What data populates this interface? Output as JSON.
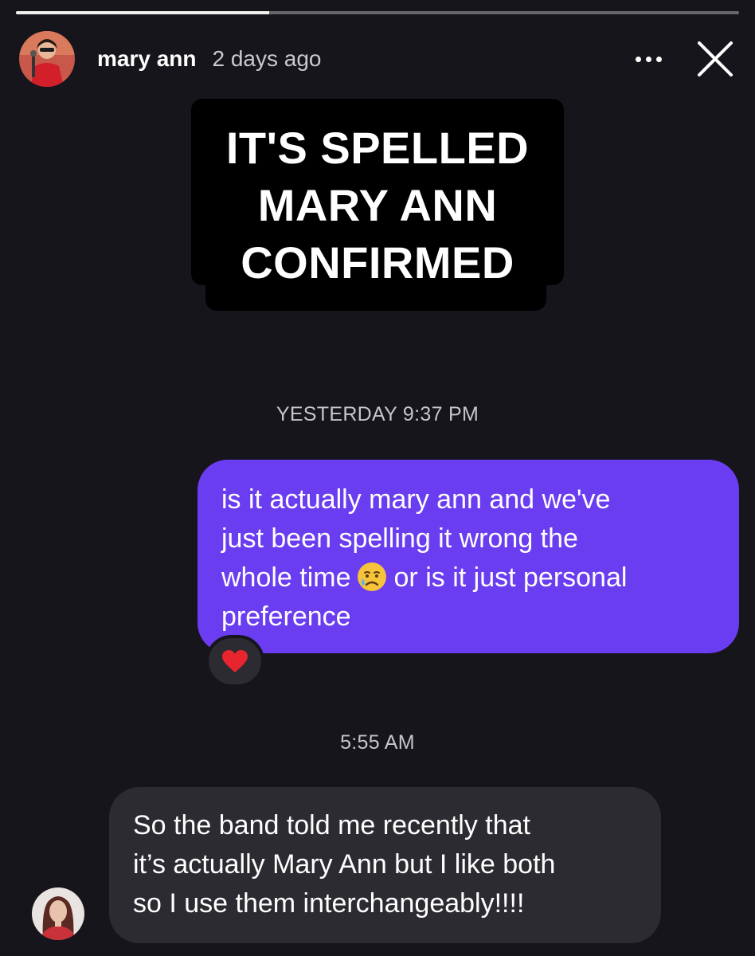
{
  "story": {
    "progress": 0.35,
    "username": "mary ann",
    "posted": "2 days ago",
    "more_icon": "more-horizontal-icon",
    "close_icon": "close-icon"
  },
  "caption": {
    "lines": [
      "IT'S SPELLED",
      "MARY ANN",
      "CONFIRMED"
    ]
  },
  "dm": {
    "time_1": "YESTERDAY 9:37 PM",
    "sent_message": {
      "lines": [
        "is it actually mary ann and we've",
        "just been spelling it wrong the",
        "whole time",
        "or is it just personal",
        "preference"
      ],
      "emoji": "sad-but-relieved-face-icon",
      "color": "#6a3df0"
    },
    "reaction_icon": "red-heart-icon",
    "time_2": "5:55 AM",
    "received_message": {
      "lines": [
        "So the band told me recently that",
        "it’s actually Mary Ann but I like both",
        "so I use them interchangeably!!!!"
      ],
      "color": "#2b2b31"
    }
  },
  "colors": {
    "background": "#16151b",
    "caption_background": "#000000"
  }
}
